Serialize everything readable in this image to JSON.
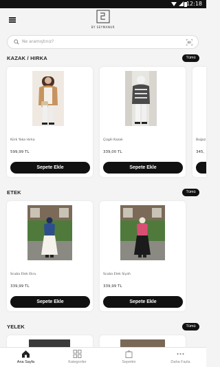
{
  "status_bar": {
    "time": "12:18"
  },
  "header": {
    "logo_text": "BY SEYMANUR"
  },
  "search": {
    "placeholder": "Ne aramıştınız?"
  },
  "sections": [
    {
      "title": "KAZAK / HIRKA",
      "all_label": "Tümü",
      "products": [
        {
          "name": "Kürk Yaka Hırka",
          "price": "599,99 TL",
          "button": "Sepete Ekle"
        },
        {
          "name": "Çizgili Kazak",
          "price": "339,00 TL",
          "button": "Sepete Ekle"
        },
        {
          "name": "Boğaz",
          "price": "345,",
          "button": ""
        }
      ]
    },
    {
      "title": "ETEK",
      "all_label": "Tümü",
      "products": [
        {
          "name": "Scuba Etek Ekru",
          "price": "339,99 TL",
          "button": "Sepete Ekle"
        },
        {
          "name": "Scuba Etek Siyah",
          "price": "339,99 TL",
          "button": "Sepete Ekle"
        }
      ]
    },
    {
      "title": "YELEK",
      "all_label": "Tümü",
      "products": []
    }
  ],
  "bottom_nav": [
    {
      "label": "Ana Sayfa",
      "icon": "home-icon",
      "active": true
    },
    {
      "label": "Kategoriler",
      "icon": "grid-icon",
      "active": false
    },
    {
      "label": "Sepetim",
      "icon": "cart-icon",
      "active": false
    },
    {
      "label": "Daha Fazla",
      "icon": "more-icon",
      "active": false
    }
  ],
  "colors": {
    "accent": "#111111",
    "background": "#f4f4f4"
  }
}
